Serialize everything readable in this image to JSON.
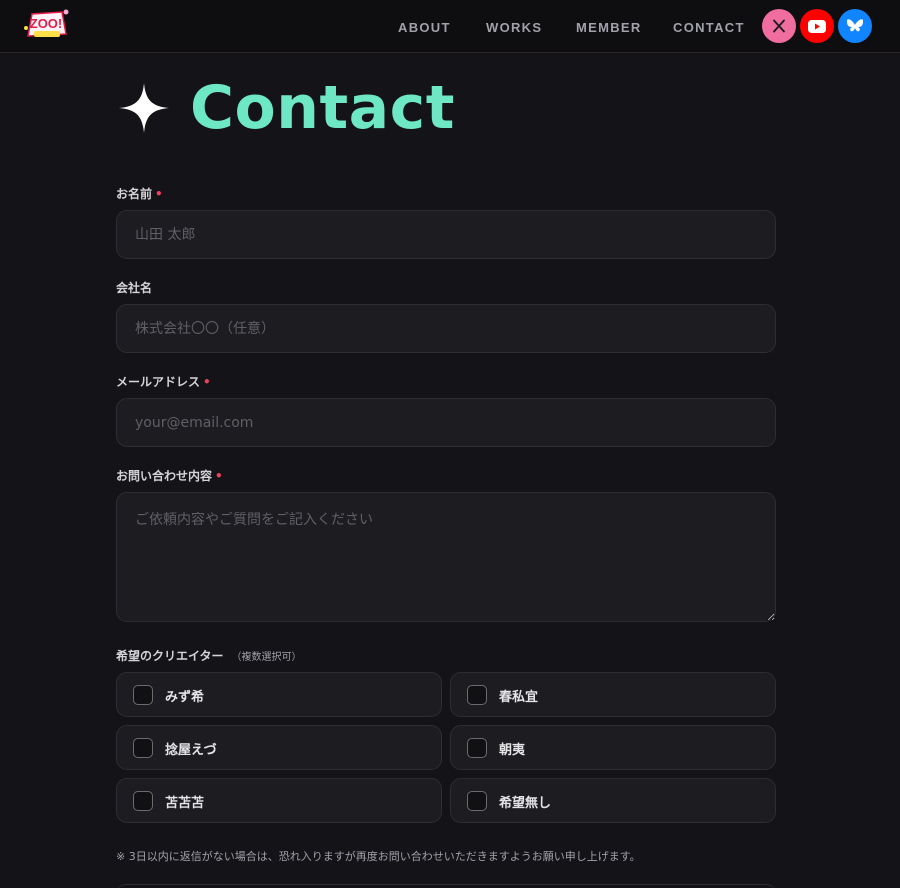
{
  "header": {
    "logo_text": "ZOO!",
    "nav": [
      "ABOUT",
      "WORKS",
      "MEMBER",
      "CONTACT"
    ],
    "social": [
      {
        "icon": "x-icon",
        "color": "#f06d9f"
      },
      {
        "icon": "youtube-icon",
        "color": "#ff0000"
      },
      {
        "icon": "bluesky-icon",
        "color": "#1185fe"
      }
    ]
  },
  "page": {
    "title": "Contact",
    "title_color": "#6ee7c5"
  },
  "form": {
    "name": {
      "label": "お名前",
      "required": "•",
      "placeholder": "山田 太郎"
    },
    "company": {
      "label": "会社名",
      "placeholder": "株式会社〇〇（任意）"
    },
    "email": {
      "label": "メールアドレス",
      "required": "•",
      "placeholder": "your@email.com"
    },
    "message": {
      "label": "お問い合わせ内容",
      "required": "•",
      "placeholder": "ご依頼内容やご質問をご記入ください"
    },
    "creators": {
      "label": "希望のクリエイター",
      "sublabel": "（複数選択可）",
      "options": [
        "みず希",
        "春私宜",
        "捻屋えづ",
        "朝夷",
        "苫苫苫",
        "希望無し"
      ]
    },
    "note": "※ 3日以内に返信がない場合は、恐れ入りますが再度お問い合わせいただきますようお願い申し上げます。"
  }
}
